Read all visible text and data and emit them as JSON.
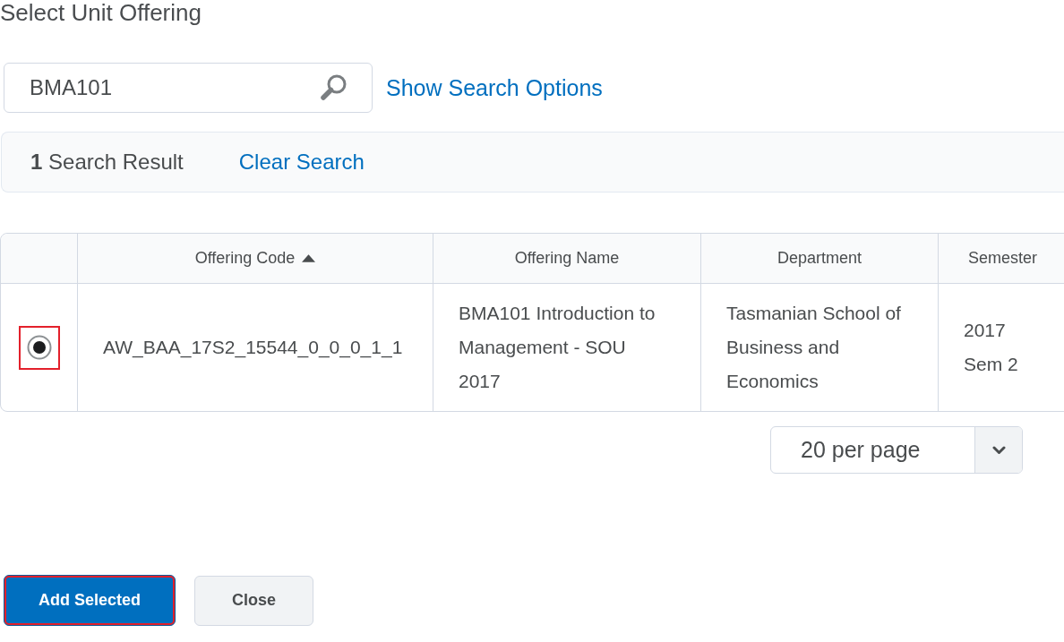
{
  "dialog": {
    "title": "Select Unit Offering"
  },
  "search": {
    "value": "BMA101",
    "options_link": "Show Search Options"
  },
  "results_bar": {
    "summary": "**1** Search Result",
    "clear_link": "Clear Search"
  },
  "table": {
    "columns": [
      {
        "label": "Offering Code",
        "sorted": true
      },
      {
        "label": "Offering Name",
        "sorted": false
      },
      {
        "label": "Department",
        "sorted": false
      },
      {
        "label": "Semester",
        "sorted": false
      }
    ],
    "rows": [
      {
        "selected": true,
        "highlighted": true,
        "cells": [
          "AW_BAA_17S2_15544_0_0_0_1_1",
          "BMA101 Introduction to Management - SOU 2017",
          "Tasmanian School of Business and Economics",
          "2017 Sem 2"
        ]
      }
    ]
  },
  "pager": {
    "value": "20 per page"
  },
  "buttons": [
    {
      "label": "Add Selected",
      "kind": "primary",
      "highlighted": true
    },
    {
      "label": "Close",
      "kind": "secondary",
      "highlighted": false
    }
  ]
}
